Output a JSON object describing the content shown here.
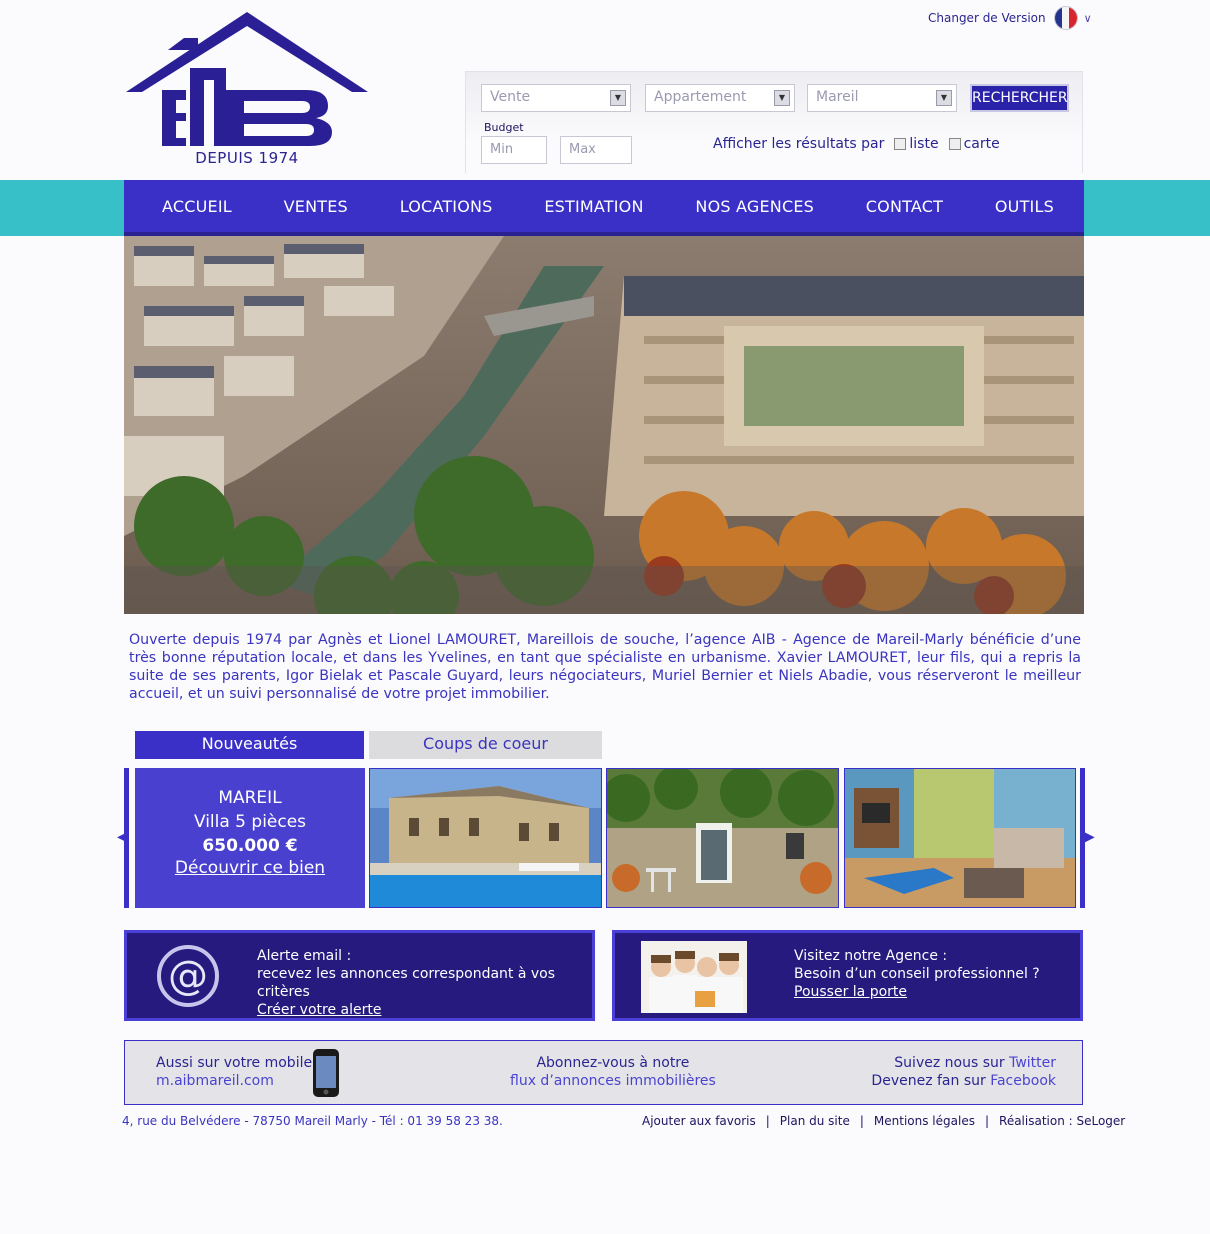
{
  "header": {
    "version_label": "Changer de Version",
    "logo_tagline": "DEPUIS 1974"
  },
  "search": {
    "transaction": "Vente",
    "property_type": "Appartement",
    "location": "Mareil",
    "button": "RECHERCHER",
    "budget_label": "Budget",
    "min_placeholder": "Min",
    "max_placeholder": "Max",
    "results_label": "Afficher les résultats par",
    "option_list": "liste",
    "option_map": "carte"
  },
  "nav": {
    "items": [
      "ACCUEIL",
      "VENTES",
      "LOCATIONS",
      "ESTIMATION",
      "NOS AGENCES",
      "CONTACT",
      "OUTILS"
    ]
  },
  "intro": "Ouverte depuis 1974 par Agnès et Lionel LAMOURET, Mareillois de souche, l’agence AIB - Agence de Mareil-Marly bénéficie d’une très bonne réputation locale, et dans les Yvelines, en tant que spécialiste en urbanisme. Xavier LAMOURET, leur fils, qui a repris la suite de ses parents, Igor Bielak et Pascale Guyard, leurs négociateurs, Muriel Bernier et Niels Abadie, vous réserveront le meilleur accueil, et un suivi personnalisé de votre projet immobilier.",
  "tabs": {
    "new": "Nouveautés",
    "favorites": "Coups de coeur"
  },
  "featured": {
    "city": "MAREIL",
    "type": "Villa 5 pièces",
    "price": "650.000 €",
    "link": "Découvrir ce bien"
  },
  "alert": {
    "line1": "Alerte email :",
    "line2": "recevez les annonces correspondant à vos critères",
    "link": "Créer votre alerte"
  },
  "agency": {
    "line1": "Visitez notre Agence :",
    "line2": "Besoin d’un conseil professionnel ?",
    "link": "Pousser la porte"
  },
  "band": {
    "mobile_line": "Aussi sur votre mobile",
    "mobile_url": "m.aibmareil.com",
    "feed_line": "Abonnez-vous à notre",
    "feed_link": "flux d’annonces immobilières",
    "twitter_prefix": "Suivez nous sur ",
    "twitter_link": "Twitter",
    "facebook_prefix": "Devenez fan sur ",
    "facebook_link": "Facebook"
  },
  "footer": {
    "address": "4, rue du Belvédere - 78750 Mareil Marly  -  Tél : 01 39 58 23 38.",
    "links": [
      "Ajouter aux favoris",
      "Plan du site",
      "Mentions légales",
      "Réalisation : SeLoger"
    ]
  },
  "colors": {
    "brand": "#3a30c8",
    "teal": "#38c0c8",
    "dark": "#261a7e"
  }
}
